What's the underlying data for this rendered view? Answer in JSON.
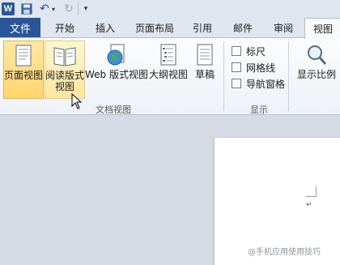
{
  "qat": {
    "logo": "W"
  },
  "tabs": {
    "file": "文件",
    "items": [
      "开始",
      "插入",
      "页面布局",
      "引用",
      "邮件",
      "审阅",
      "视图"
    ],
    "active_index": 6
  },
  "ribbon": {
    "doc_views": {
      "print_layout": "页面视图",
      "reading_line1": "阅读版式",
      "reading_line2": "视图",
      "web_layout": "Web 版式视图",
      "outline": "大纲视图",
      "draft": "草稿",
      "group_label": "文档视图"
    },
    "show": {
      "ruler": "标尺",
      "gridlines": "网格线",
      "nav_pane": "导航窗格",
      "group_label": "显示"
    },
    "zoom": {
      "label": "显示比例"
    }
  },
  "document": {
    "paragraph_mark": "↵"
  },
  "watermark": "@手机应用使用技巧",
  "colors": {
    "file_tab": "#2a5699",
    "active_button": "#ffd56b",
    "ribbon_bg": "#f4f6f8"
  }
}
